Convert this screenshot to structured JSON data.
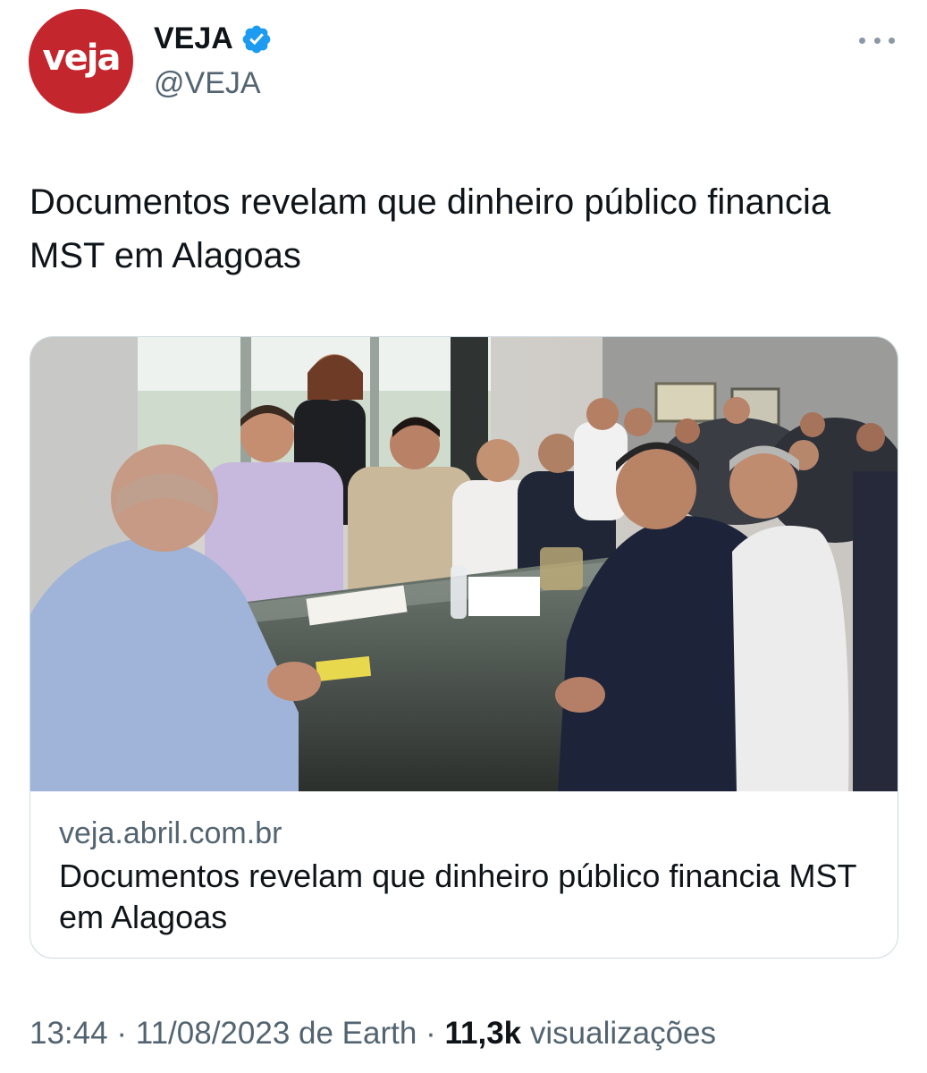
{
  "account": {
    "avatar_text": "veja",
    "display_name": "VEJA",
    "handle": "@VEJA",
    "verified": true,
    "avatar_color": "#c4262e",
    "verified_color": "#1d9bf0"
  },
  "icons": {
    "more": "more-horizontal-icon",
    "verified": "verified-badge-icon"
  },
  "tweet": {
    "text": "Documentos revelam que dinheiro público financia MST em Alagoas"
  },
  "card": {
    "image_subject": "meeting-photo",
    "domain": "veja.abril.com.br",
    "title": "Documentos revelam que dinheiro público financia MST em Alagoas"
  },
  "meta": {
    "time": "13:44",
    "separator": "·",
    "date": "11/08/2023",
    "source": "de Earth",
    "views_count": "11,3k",
    "views_label": "visualizações"
  }
}
